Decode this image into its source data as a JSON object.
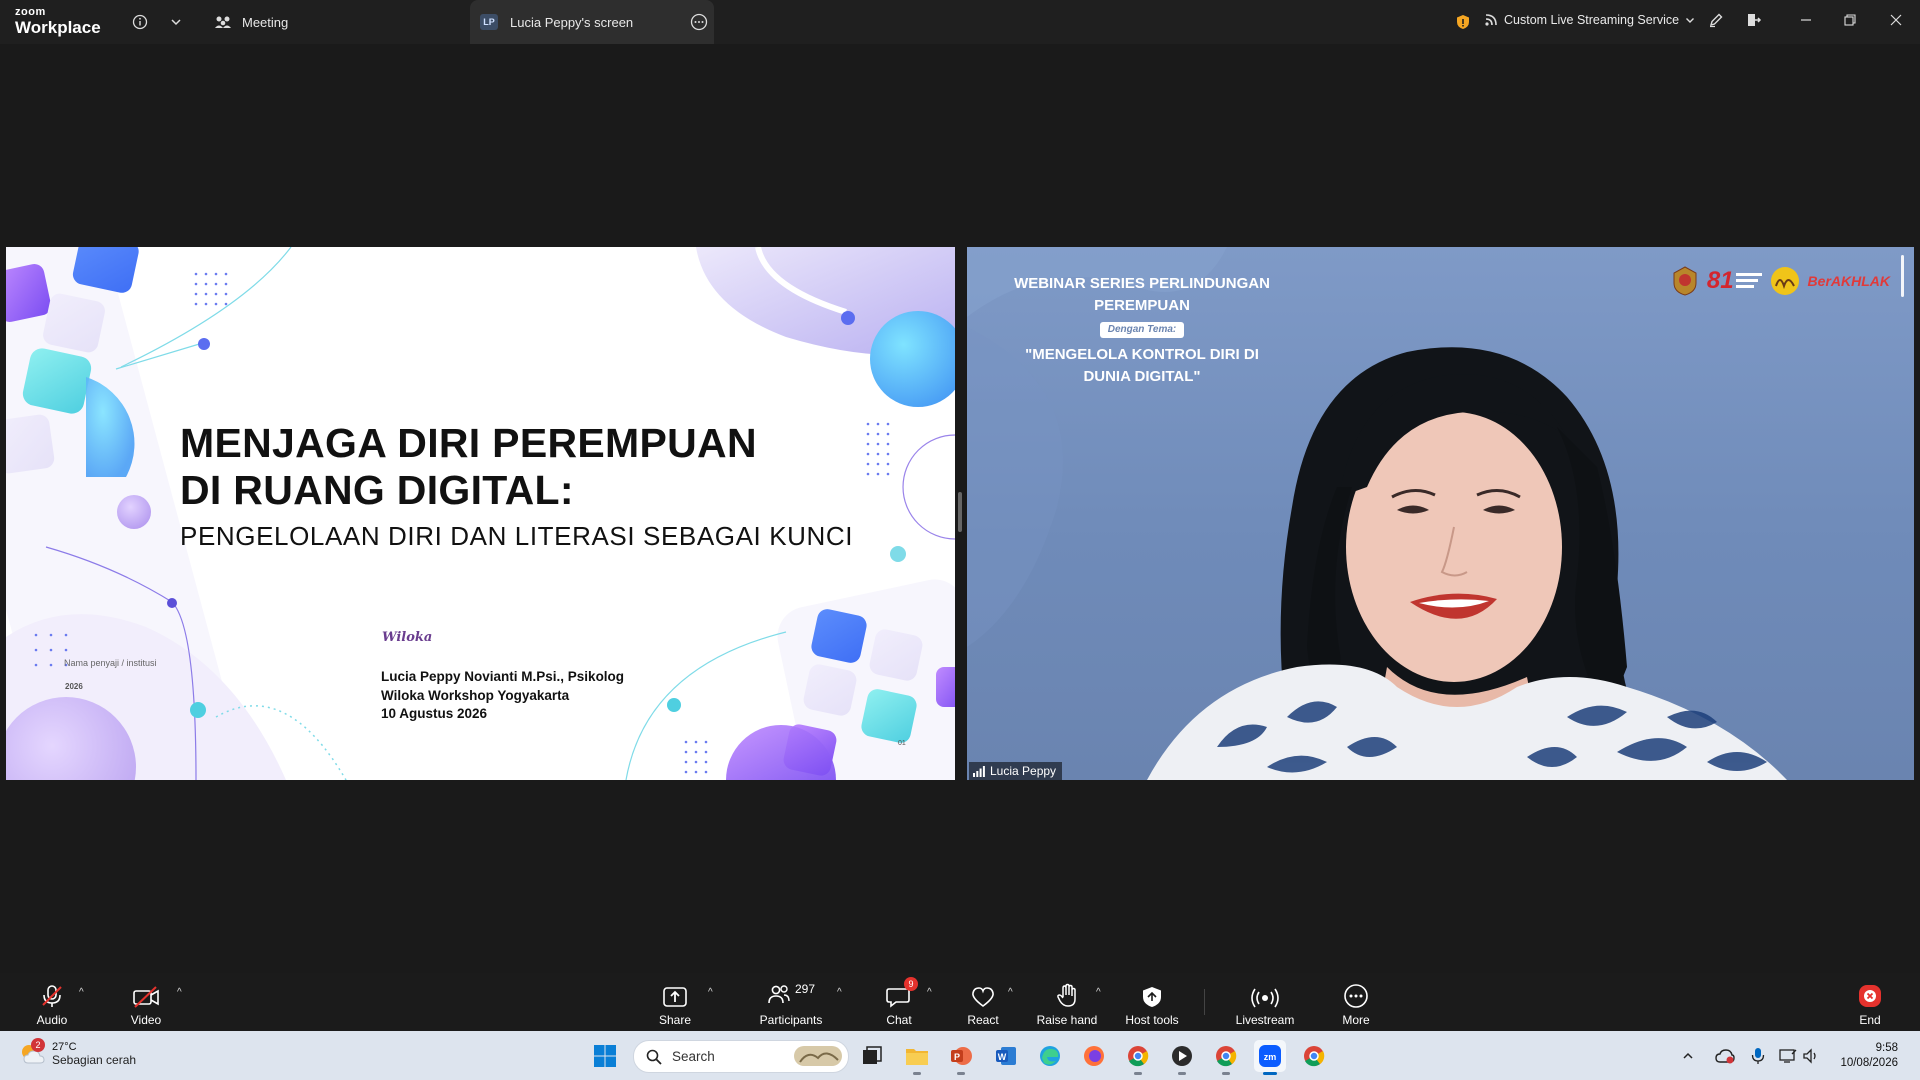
{
  "titlebar": {
    "brand_top": "zoom",
    "brand_bottom": "Workplace",
    "meeting_tab": "Meeting",
    "screen_tab": "Lucia Peppy's screen",
    "screen_tab_badge": "LP",
    "streaming": "Custom Live Streaming Service"
  },
  "slide": {
    "title_line1": "MENJAGA DIRI PEREMPUAN",
    "title_line2": "DI RUANG DIGITAL:",
    "subtitle": "PENGELOLAAN DIRI DAN LITERASI SEBAGAI KUNCI",
    "logo_text": "Wiloka",
    "presenter_line1": "Lucia Peppy Novianti M.Psi., Psikolog",
    "presenter_line2": "Wiloka Workshop Yogyakarta",
    "presenter_line3": "10 Agustus 2026",
    "nama_placeholder": "Nama penyaji / institusi",
    "year": "2026",
    "slide_number": "01"
  },
  "video": {
    "header_line1": "WEBINAR SERIES PERLINDUNGAN",
    "header_line2": "PEREMPUAN",
    "tema_label": "Dengan Tema:",
    "quote_line1": "\"MENGELOLA KONTROL DIRI DI",
    "quote_line2": "DUNIA DIGITAL\"",
    "logo_81": "81",
    "logo_berakhlak": "BerAKHLAK",
    "participant_name": "Lucia Peppy"
  },
  "toolbar": {
    "audio": "Audio",
    "video": "Video",
    "share": "Share",
    "participants": "Participants",
    "participants_count": "297",
    "chat": "Chat",
    "chat_badge": "9",
    "react": "React",
    "raise_hand": "Raise hand",
    "host_tools": "Host tools",
    "livestream": "Livestream",
    "more": "More",
    "end": "End"
  },
  "taskbar": {
    "weather_badge": "2",
    "temperature": "27°C",
    "condition": "Sebagian cerah",
    "search_placeholder": "Search",
    "time": "9:58",
    "date": "10/08/2026"
  },
  "colors": {
    "accent_purple": "#8b5cf6",
    "accent_cyan": "#4fd1e8",
    "end_red": "#e5322d",
    "win_blue": "#0067c0"
  }
}
